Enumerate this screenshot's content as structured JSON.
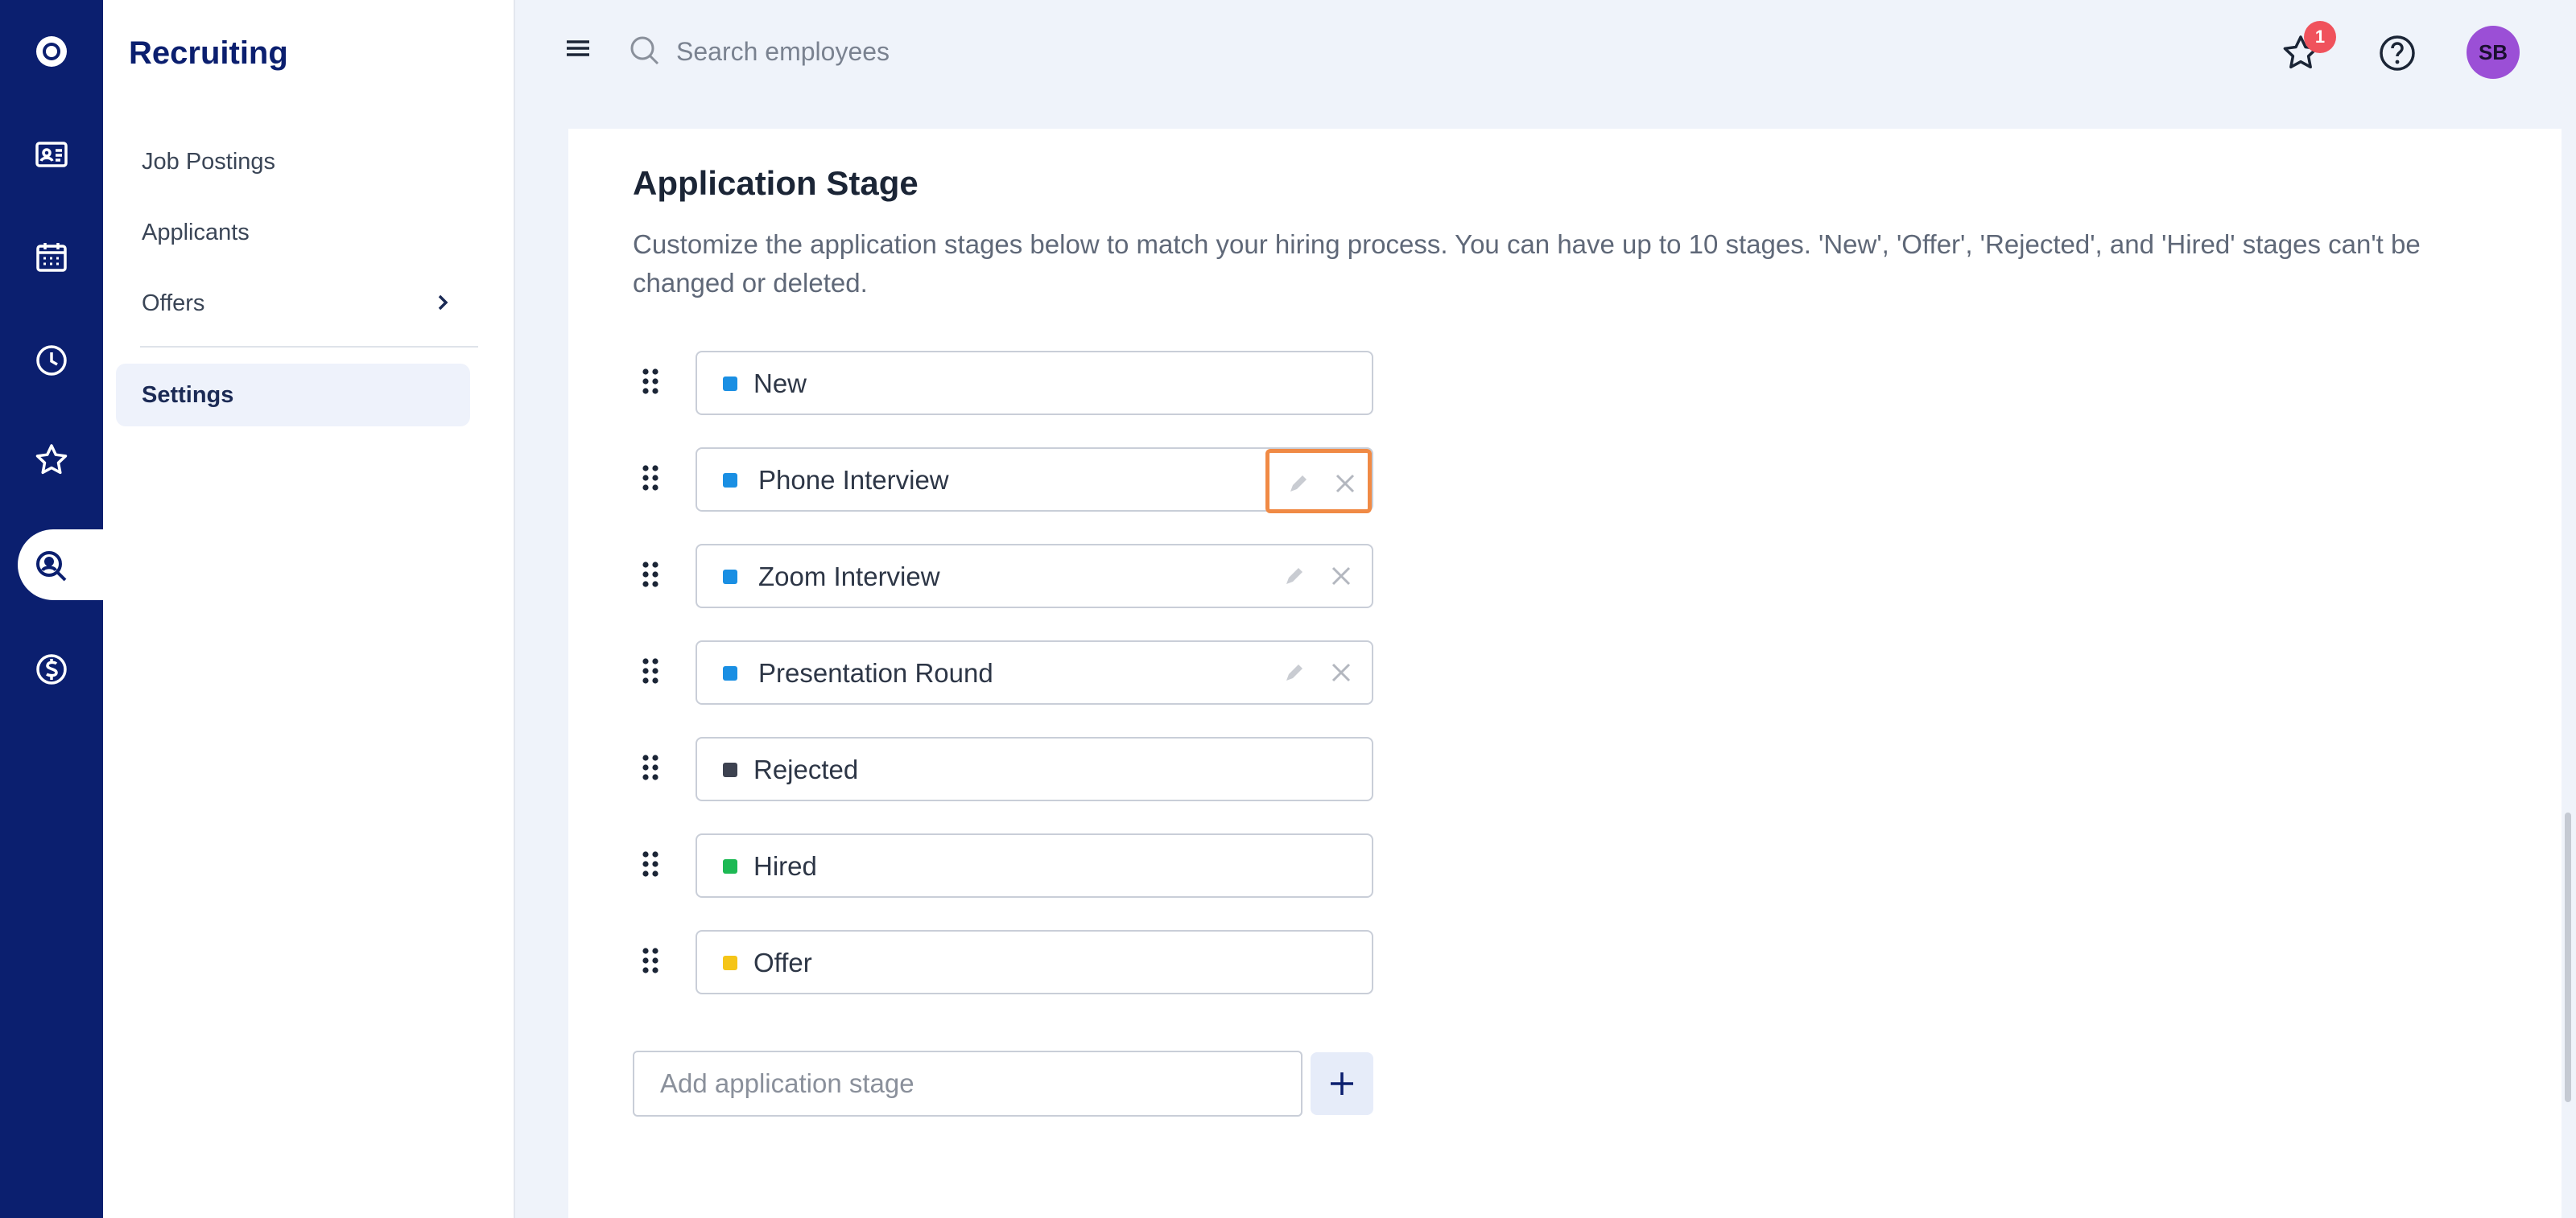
{
  "app": {
    "title": "Recruiting",
    "rail_icons": [
      "logo-icon",
      "id-card-icon",
      "calendar-icon",
      "clock-icon",
      "star-icon",
      "recruiting-search-icon",
      "dollar-icon"
    ],
    "active_rail_index": 5
  },
  "subnav": {
    "items": [
      {
        "label": "Job Postings"
      },
      {
        "label": "Applicants"
      },
      {
        "label": "Offers",
        "has_submenu": true
      },
      {
        "label": "Settings",
        "active": true
      }
    ]
  },
  "topbar": {
    "search_placeholder": "Search employees",
    "notification_count": "1",
    "avatar_initials": "SB"
  },
  "main": {
    "title": "Application Stage",
    "description": "Customize the application stages below to match your hiring process. You can have up to 10 stages. 'New', 'Offer', 'Rejected', and 'Hired' stages can't be changed or deleted.",
    "stages": [
      {
        "label": "New",
        "color": "#1a8fe3",
        "editable": false
      },
      {
        "label": "Phone Interview",
        "color": "#1a8fe3",
        "editable": true,
        "highlighted": true
      },
      {
        "label": "Zoom Interview",
        "color": "#1a8fe3",
        "editable": true
      },
      {
        "label": "Presentation Round",
        "color": "#1a8fe3",
        "editable": true
      },
      {
        "label": "Rejected",
        "color": "#3d4250",
        "editable": false
      },
      {
        "label": "Hired",
        "color": "#1db954",
        "editable": false
      },
      {
        "label": "Offer",
        "color": "#f5c518",
        "editable": false
      }
    ],
    "add_stage_placeholder": "Add application stage"
  },
  "colors": {
    "rail": "#0b1f6f",
    "highlight": "#f08a45",
    "badge": "#f0525c",
    "avatar": "#9b4fd6"
  }
}
